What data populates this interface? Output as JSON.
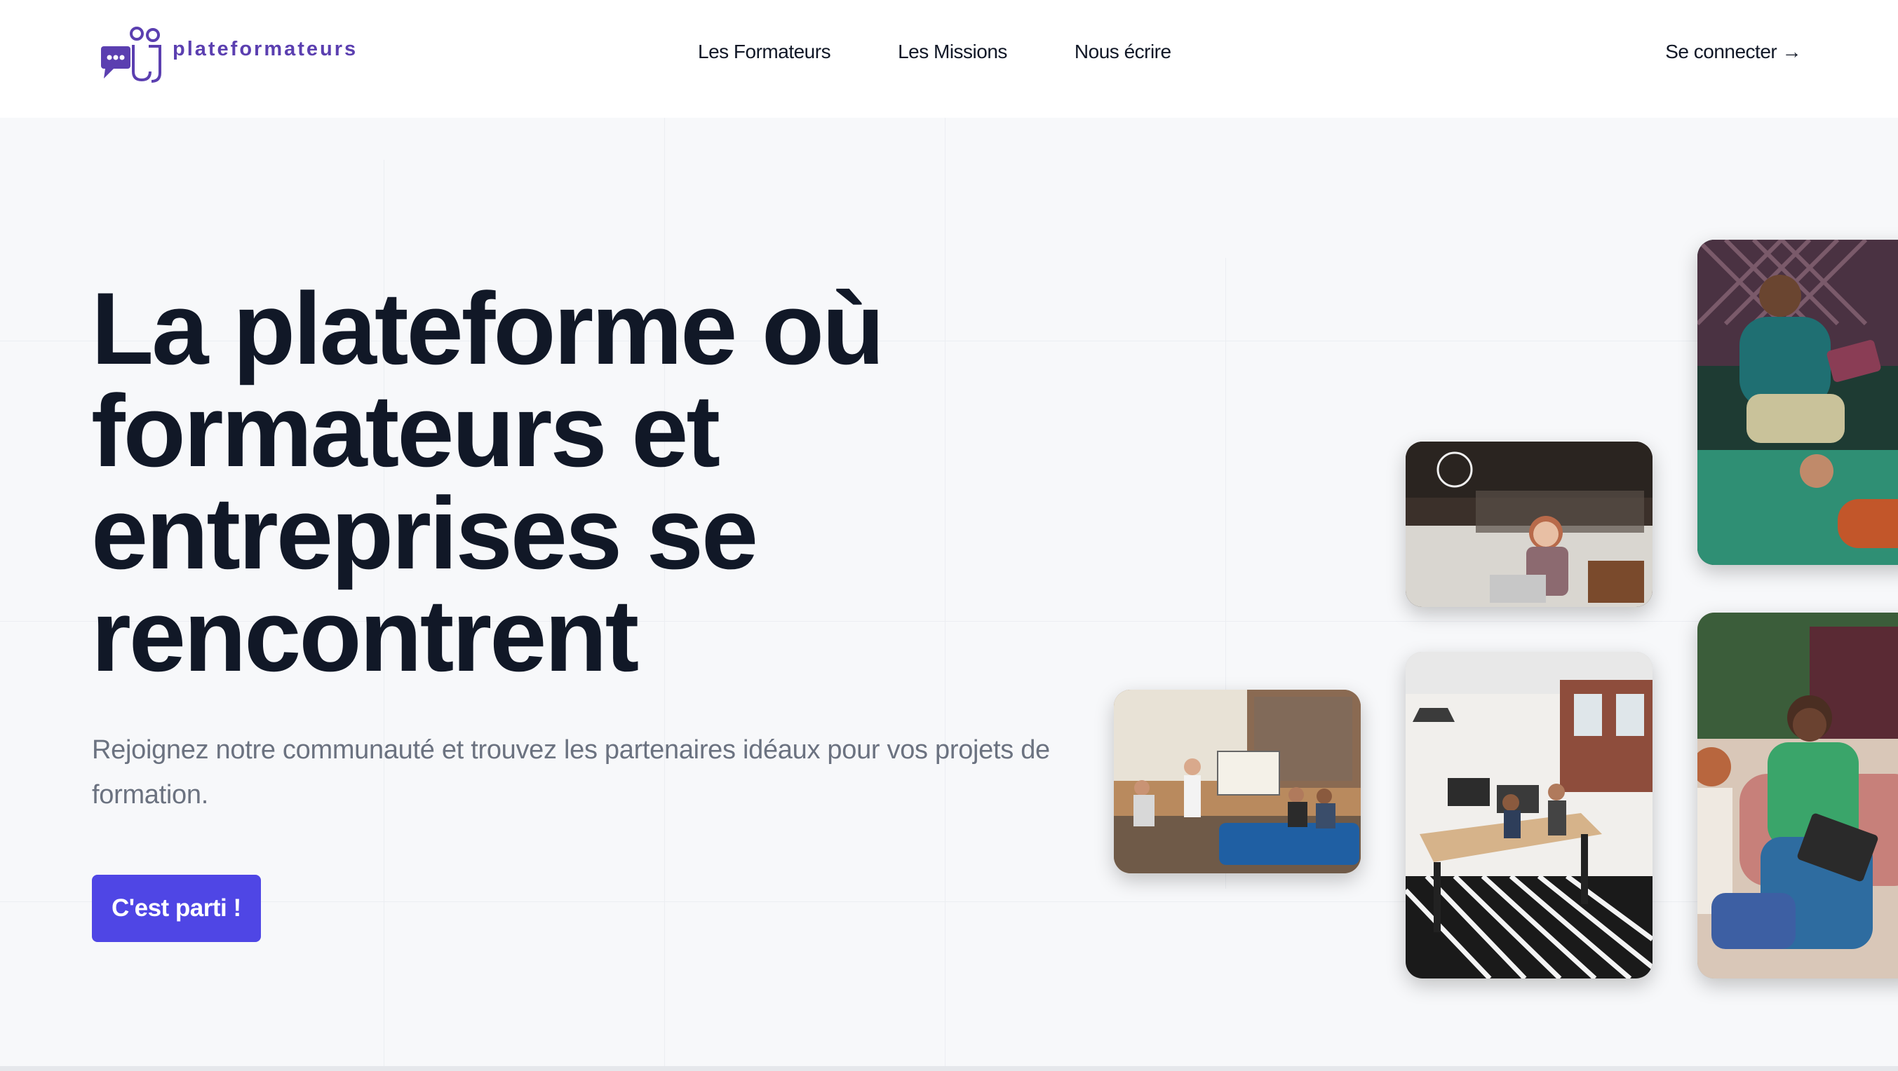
{
  "brand": {
    "name": "plateformateurs",
    "logo_icon": "chat-people-icon",
    "accent_color": "#5b3fb0"
  },
  "nav": {
    "items": [
      {
        "label": "Les Formateurs"
      },
      {
        "label": "Les Missions"
      },
      {
        "label": "Nous écrire"
      }
    ],
    "login_label": "Se connecter →"
  },
  "hero": {
    "headline_lines": [
      "La plateforme où",
      "formateurs et",
      "entreprises se",
      "rencontrent"
    ],
    "subtitle": "Rejoignez notre communauté et trouvez les partenaires idéaux pour vos projets de formation.",
    "cta_label": "C'est parti !",
    "cta_color": "#4f46e5"
  },
  "photos": [
    {
      "name": "team-meeting-photo"
    },
    {
      "name": "woman-laptop-photo"
    },
    {
      "name": "open-office-photo"
    },
    {
      "name": "man-tablet-photo"
    },
    {
      "name": "group-laughing-photo"
    }
  ]
}
